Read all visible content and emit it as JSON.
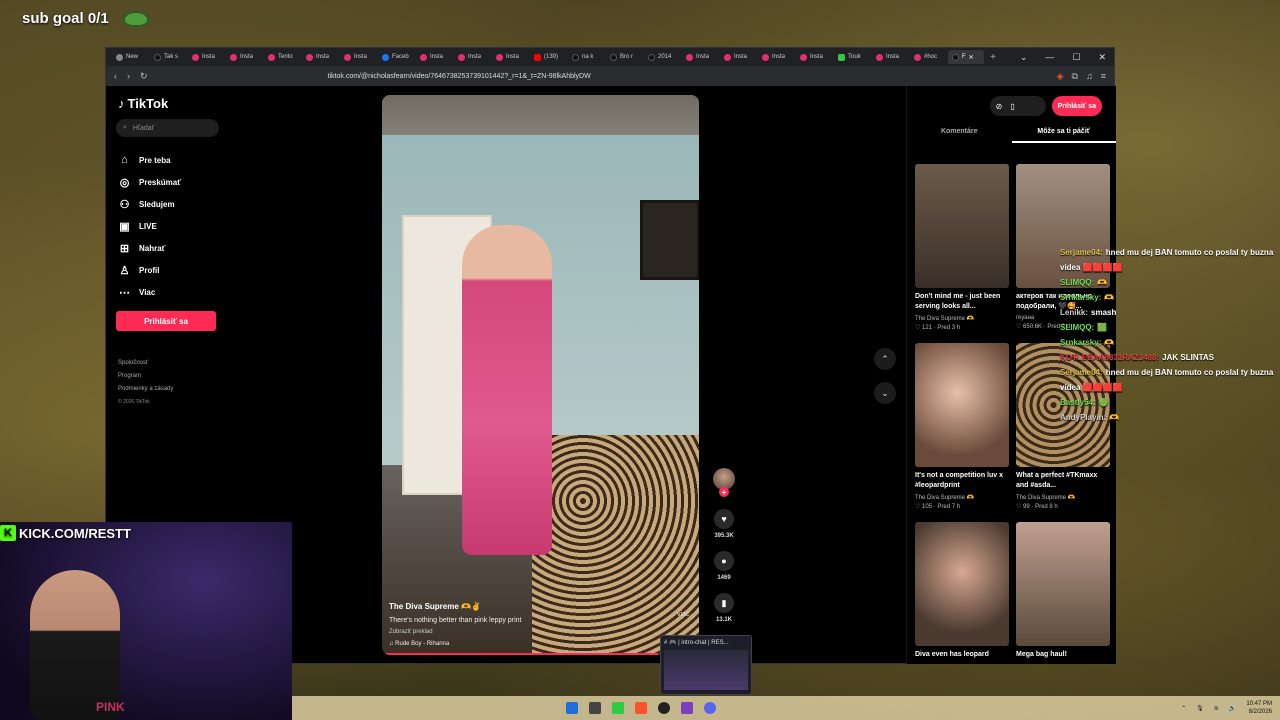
{
  "overlay": {
    "sub_goal": "sub goal 0/1",
    "kick_url": "KICK.COM/RESTT",
    "shirt_text": "PINK"
  },
  "browser": {
    "tabs": [
      "New",
      "Tak s",
      "Insta",
      "Insta",
      "Tento",
      "Insta",
      "Insta",
      "Faceb",
      "Insta",
      "Insta",
      "Insta",
      "(139)",
      "na k",
      "Bro r",
      "2014",
      "Insta",
      "Insta",
      "Insta",
      "Insta",
      "Touk",
      "Insta",
      "#hoc",
      "F"
    ],
    "url": "tiktok.com/@nicholasfearn/video/7646738253739101442?_r=1&_t=ZN-98lkAhblyDW"
  },
  "tiktok": {
    "logo": "TikTok",
    "search_placeholder": "Hľadať",
    "nav": [
      {
        "label": "Pre teba",
        "icon": "home-icon"
      },
      {
        "label": "Preskúmať",
        "icon": "compass-icon"
      },
      {
        "label": "Sledujem",
        "icon": "following-icon"
      },
      {
        "label": "LIVE",
        "icon": "live-icon"
      },
      {
        "label": "Nahrať",
        "icon": "upload-icon"
      },
      {
        "label": "Profil",
        "icon": "profile-icon"
      },
      {
        "label": "Viac",
        "icon": "more-icon"
      }
    ],
    "login": "Prihlásiť sa",
    "footer": [
      "Spoločnosť",
      "Program",
      "Podmienky a zásady"
    ],
    "copyright": "© 2026 TikTok",
    "video": {
      "author": "The Diva Supreme 🫶✌️",
      "description": "There's nothing better than pink leppy print",
      "translation": "Zobraziť preklad",
      "music": "Rude Boy - Rihanna",
      "progress": 0.87
    },
    "actions": {
      "likes": "395.3K",
      "comments": "1469",
      "saves": "13.1K",
      "more": "viac"
    },
    "right_panel": {
      "login": "Prihlásiť sa",
      "tabs": [
        "Komentáre",
        "Môže sa ti páčiť"
      ],
      "cards": [
        {
          "title": "Don't mind me - just been serving looks all...",
          "author": "The Diva Supreme 🫶",
          "likes": "121",
          "time": "Pred 3 h"
        },
        {
          "title": "актеров так идеально подобрали, 🖤🥰...",
          "author": "геуана",
          "likes": "650.6K",
          "time": "Pred 2 d"
        },
        {
          "title": "It's not a competition luv x #leopardprint",
          "author": "The Diva Supreme 🫶",
          "likes": "105",
          "time": "Pred 7 h"
        },
        {
          "title": "What a perfect #TKmaxx and #asda...",
          "author": "The Diva Supreme 🫶",
          "likes": "99",
          "time": "Pred 8 h"
        },
        {
          "title": "Diva even has leopard",
          "author": "",
          "likes": "",
          "time": ""
        },
        {
          "title": "Mega bag haul!",
          "author": "",
          "likes": "",
          "time": ""
        }
      ]
    }
  },
  "chat": [
    {
      "user": "Serjame04:",
      "color": "yel",
      "msg": "hned mu dej BAN tomuto co poslal ty buzna videa 🟥🟥🟥🟥"
    },
    {
      "user": "SLIMQQ:",
      "color": "grn",
      "msg": "🫶"
    },
    {
      "user": "Srnkarsky:",
      "color": "grn",
      "msg": "🫶"
    },
    {
      "user": "Lenikk:",
      "color": "grey",
      "msg": "smash"
    },
    {
      "user": "SLIMQQ:",
      "color": "grn",
      "msg": "🟩"
    },
    {
      "user": "Srnkarsky:",
      "color": "grn",
      "msg": "🫶"
    },
    {
      "user": "KOTLEBAA8831RAZ1488:",
      "color": "red",
      "msg": "JAK SLINTAS"
    },
    {
      "user": "Serjame04:",
      "color": "yel",
      "msg": "hned mu dej BAN tomuto co poslal ty buzna videa 🟥🟥🟥🟥"
    },
    {
      "user": "Bastly54:",
      "color": "grn",
      "msg": "🟢"
    },
    {
      "user": "AndyPlayin:",
      "color": "grey",
      "msg": "🫶"
    }
  ],
  "popup": {
    "title": "# 🎮 | intro-chat | RES..."
  },
  "taskbar": {
    "time": "10:47 PM",
    "date": "8/2/2026"
  }
}
